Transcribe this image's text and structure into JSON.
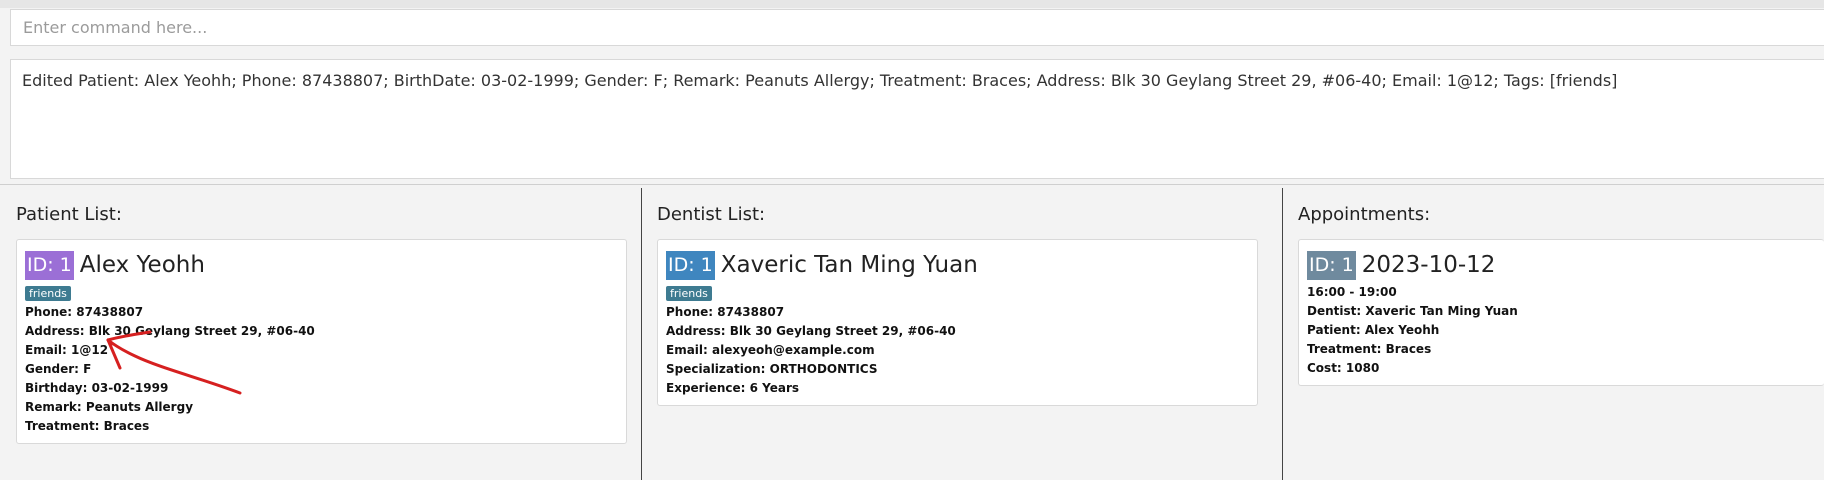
{
  "command": {
    "placeholder": "Enter command here...",
    "value": ""
  },
  "result": {
    "text": "Edited Patient: Alex Yeohh; Phone: 87438807; BirthDate: 03-02-1999; Gender: F; Remark: Peanuts Allergy; Treatment: Braces; Address: Blk 30 Geylang Street 29, #06-40; Email: 1@12; Tags: [friends]"
  },
  "colors": {
    "patient_id_badge": "#9b6fd6",
    "dentist_id_badge": "#3f86bf",
    "appointment_id_badge": "#6f8a9e",
    "tag": "#3e7b91",
    "annotation": "#d62020"
  },
  "patients": {
    "title": "Patient List:",
    "cards": [
      {
        "id_label": "ID: 1",
        "name": "Alex Yeohh",
        "tag": "friends",
        "phone": "Phone: 87438807",
        "address": "Address: Blk 30 Geylang Street 29, #06-40",
        "email": "Email: 1@12",
        "gender": "Gender: F",
        "birthday": "Birthday: 03-02-1999",
        "remark": "Remark: Peanuts Allergy",
        "treatment": "Treatment: Braces"
      }
    ]
  },
  "dentists": {
    "title": "Dentist List:",
    "cards": [
      {
        "id_label": "ID: 1",
        "name": "Xaveric Tan Ming Yuan",
        "tag": "friends",
        "phone": "Phone: 87438807",
        "address": "Address: Blk 30 Geylang Street 29, #06-40",
        "email": "Email: alexyeoh@example.com",
        "specialization": "Specialization: ORTHODONTICS",
        "experience": "Experience: 6 Years"
      }
    ]
  },
  "appointments": {
    "title": "Appointments:",
    "cards": [
      {
        "id_label": "ID: 1",
        "date": "2023-10-12",
        "time": "16:00 - 19:00",
        "dentist": "Dentist: Xaveric Tan Ming Yuan",
        "patient": "Patient: Alex Yeohh",
        "treatment": "Treatment: Braces",
        "cost": "Cost: 1080"
      }
    ]
  }
}
